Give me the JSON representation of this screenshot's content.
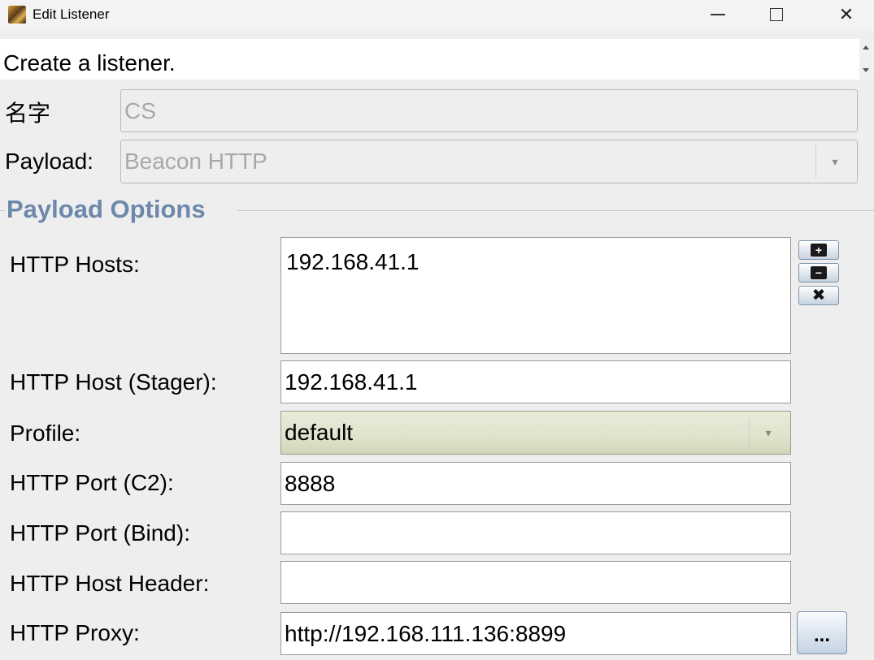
{
  "window": {
    "title": "Edit Listener",
    "minimize_glyph": "—",
    "close_glyph": "✕"
  },
  "description": "Create a listener.",
  "name": {
    "label": "名字",
    "value": "CS"
  },
  "payload": {
    "label": "Payload:",
    "value": "Beacon HTTP"
  },
  "section": {
    "title": "Payload Options"
  },
  "options": {
    "hosts": {
      "label": "HTTP Hosts:",
      "value": "192.168.41.1"
    },
    "host_stager": {
      "label": "HTTP Host (Stager):",
      "value": "192.168.41.1"
    },
    "profile": {
      "label": "Profile:",
      "value": "default"
    },
    "port_c2": {
      "label": "HTTP Port (C2):",
      "value": "8888"
    },
    "port_bind": {
      "label": "HTTP Port (Bind):",
      "value": ""
    },
    "host_header": {
      "label": "HTTP Host Header:",
      "value": ""
    },
    "proxy": {
      "label": "HTTP Proxy:",
      "value": "http://192.168.111.136:8899",
      "button_label": "..."
    }
  },
  "icons": {
    "combo_arrow": "▾",
    "add": "+",
    "remove": "−",
    "clear": "✖"
  },
  "colors": {
    "section_title": "#6d88aa",
    "profile_background": "#dfe3cc"
  }
}
